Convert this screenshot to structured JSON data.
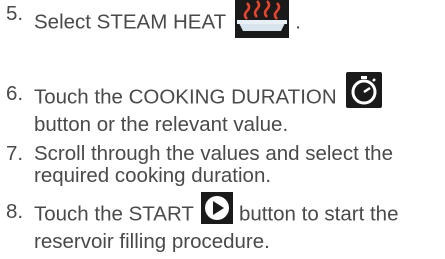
{
  "steps": [
    {
      "num": "5.",
      "pre": "Select STEAM HEAT",
      "post": ".",
      "icon": "steam-heat-icon"
    },
    {
      "num": "6.",
      "pre": "Touch the COOKING DURATION",
      "line2": "button or the relevant value.",
      "icon": "stopwatch-icon"
    },
    {
      "num": "7.",
      "line1": "Scroll through the values and select the",
      "line2": "required cooking duration."
    },
    {
      "num": "8.",
      "pre": "Touch the START",
      "post": "button to start the",
      "line2": "reservoir filling procedure.",
      "icon": "play-icon"
    }
  ],
  "colors": {
    "text": "#4a4a4a",
    "icon_bg": "#1a1a1a",
    "steam": "#e8452c",
    "plate": "#d8e4ee"
  }
}
